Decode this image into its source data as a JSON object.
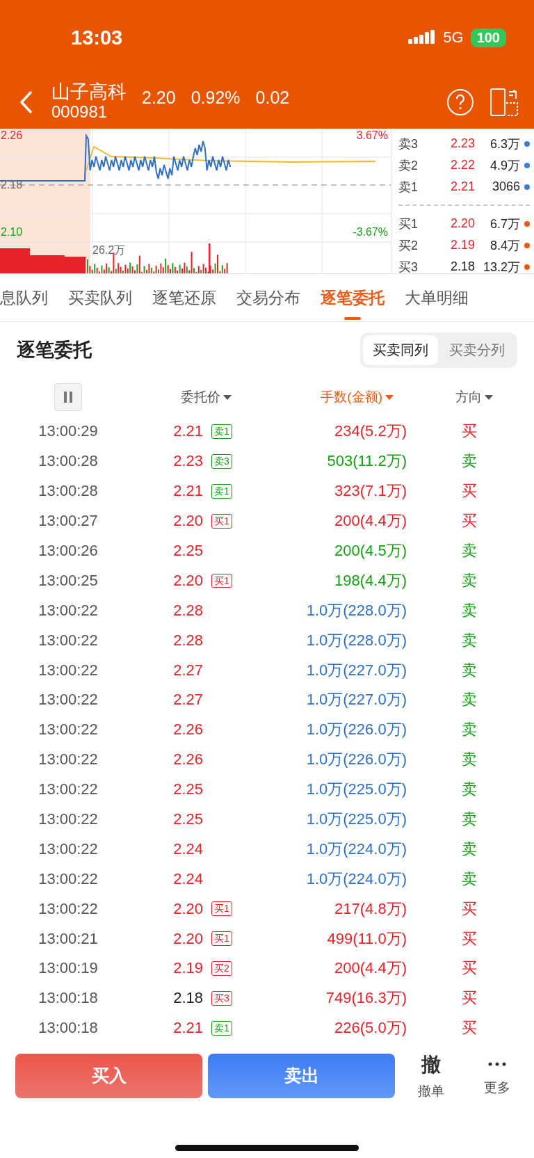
{
  "status_bar": {
    "time": "13:03",
    "network": "5G",
    "battery": "100"
  },
  "header": {
    "name": "山子高科",
    "code": "000981",
    "price": "2.20",
    "change_pct": "0.92%",
    "change": "0.02"
  },
  "chart": {
    "price_high": "2.26",
    "prev_close": "2.18",
    "price_low": "2.10",
    "pct_high": "3.67%",
    "pct_low": "-3.67%",
    "volume_label": "26.2万"
  },
  "order_book": {
    "asks": [
      {
        "label": "卖3",
        "price": "2.23",
        "rising": true,
        "volume": "6.3万",
        "color": "#3b7dd8"
      },
      {
        "label": "卖2",
        "price": "2.22",
        "rising": true,
        "volume": "4.9万",
        "color": "#3b7dd8"
      },
      {
        "label": "卖1",
        "price": "2.21",
        "rising": true,
        "volume": "3066",
        "color": "#3b7dd8"
      }
    ],
    "bids": [
      {
        "label": "买1",
        "price": "2.20",
        "rising": true,
        "volume": "6.7万",
        "color": "#ea5a0c"
      },
      {
        "label": "买2",
        "price": "2.19",
        "rising": true,
        "volume": "8.4万",
        "color": "#ea5a0c"
      },
      {
        "label": "买3",
        "price": "2.18",
        "rising": false,
        "volume": "13.2万",
        "color": "#ea5a0c"
      }
    ]
  },
  "tabs": [
    {
      "label": "息队列",
      "selected": false
    },
    {
      "label": "买卖队列",
      "selected": false
    },
    {
      "label": "逐笔还原",
      "selected": false
    },
    {
      "label": "交易分布",
      "selected": false
    },
    {
      "label": "逐笔委托",
      "selected": true
    },
    {
      "label": "大单明细",
      "selected": false
    }
  ],
  "section": {
    "title": "逐笔委托",
    "modes": [
      {
        "label": "买卖同列",
        "selected": true
      },
      {
        "label": "买卖分列",
        "selected": false
      }
    ]
  },
  "table": {
    "columns": [
      {
        "label": "委托价",
        "selected": false
      },
      {
        "label": "手数(金额)",
        "selected": true
      },
      {
        "label": "方向",
        "selected": false
      }
    ],
    "rows": [
      {
        "time": "13:00:29",
        "price": "2.21",
        "rising": true,
        "tag": {
          "text": "卖1",
          "kind": "sell"
        },
        "amount": "234(5.2万)",
        "kind": "buy",
        "direction": "买",
        "is_buy": true
      },
      {
        "time": "13:00:28",
        "price": "2.23",
        "rising": true,
        "tag": {
          "text": "卖3",
          "kind": "sell"
        },
        "amount": "503(11.2万)",
        "kind": "sell",
        "direction": "卖",
        "is_buy": false
      },
      {
        "time": "13:00:28",
        "price": "2.21",
        "rising": true,
        "tag": {
          "text": "卖1",
          "kind": "sell"
        },
        "amount": "323(7.1万)",
        "kind": "buy",
        "direction": "买",
        "is_buy": true
      },
      {
        "time": "13:00:27",
        "price": "2.20",
        "rising": true,
        "tag": {
          "text": "买1",
          "kind": "buy"
        },
        "amount": "200(4.4万)",
        "kind": "buy",
        "direction": "买",
        "is_buy": true
      },
      {
        "time": "13:00:26",
        "price": "2.25",
        "rising": true,
        "amount": "200(4.5万)",
        "kind": "sell",
        "direction": "卖",
        "is_buy": false
      },
      {
        "time": "13:00:25",
        "price": "2.20",
        "rising": true,
        "tag": {
          "text": "买1",
          "kind": "buy"
        },
        "amount": "198(4.4万)",
        "kind": "sell",
        "direction": "卖",
        "is_buy": false
      },
      {
        "time": "13:00:22",
        "price": "2.28",
        "rising": true,
        "amount": "1.0万(228.0万)",
        "kind": "large",
        "direction": "卖",
        "is_buy": false
      },
      {
        "time": "13:00:22",
        "price": "2.28",
        "rising": true,
        "amount": "1.0万(228.0万)",
        "kind": "large",
        "direction": "卖",
        "is_buy": false
      },
      {
        "time": "13:00:22",
        "price": "2.27",
        "rising": true,
        "amount": "1.0万(227.0万)",
        "kind": "large",
        "direction": "卖",
        "is_buy": false
      },
      {
        "time": "13:00:22",
        "price": "2.27",
        "rising": true,
        "amount": "1.0万(227.0万)",
        "kind": "large",
        "direction": "卖",
        "is_buy": false
      },
      {
        "time": "13:00:22",
        "price": "2.26",
        "rising": true,
        "amount": "1.0万(226.0万)",
        "kind": "large",
        "direction": "卖",
        "is_buy": false
      },
      {
        "time": "13:00:22",
        "price": "2.26",
        "rising": true,
        "amount": "1.0万(226.0万)",
        "kind": "large",
        "direction": "卖",
        "is_buy": false
      },
      {
        "time": "13:00:22",
        "price": "2.25",
        "rising": true,
        "amount": "1.0万(225.0万)",
        "kind": "large",
        "direction": "卖",
        "is_buy": false
      },
      {
        "time": "13:00:22",
        "price": "2.25",
        "rising": true,
        "amount": "1.0万(225.0万)",
        "kind": "large",
        "direction": "卖",
        "is_buy": false
      },
      {
        "time": "13:00:22",
        "price": "2.24",
        "rising": true,
        "amount": "1.0万(224.0万)",
        "kind": "large",
        "direction": "卖",
        "is_buy": false
      },
      {
        "time": "13:00:22",
        "price": "2.24",
        "rising": true,
        "amount": "1.0万(224.0万)",
        "kind": "large",
        "direction": "卖",
        "is_buy": false
      },
      {
        "time": "13:00:22",
        "price": "2.20",
        "rising": true,
        "tag": {
          "text": "买1",
          "kind": "buy"
        },
        "amount": "217(4.8万)",
        "kind": "buy",
        "direction": "买",
        "is_buy": true
      },
      {
        "time": "13:00:21",
        "price": "2.20",
        "rising": true,
        "tag": {
          "text": "买1",
          "kind": "buy"
        },
        "amount": "499(11.0万)",
        "kind": "buy",
        "direction": "买",
        "is_buy": true
      },
      {
        "time": "13:00:19",
        "price": "2.19",
        "rising": true,
        "tag": {
          "text": "买2",
          "kind": "buy"
        },
        "amount": "200(4.4万)",
        "kind": "buy",
        "direction": "买",
        "is_buy": true
      },
      {
        "time": "13:00:18",
        "price": "2.18",
        "rising": false,
        "tag": {
          "text": "买3",
          "kind": "buy"
        },
        "amount": "749(16.3万)",
        "kind": "buy",
        "direction": "买",
        "is_buy": true
      },
      {
        "time": "13:00:18",
        "price": "2.21",
        "rising": true,
        "tag": {
          "text": "卖1",
          "kind": "sell"
        },
        "amount": "226(5.0万)",
        "kind": "buy",
        "direction": "买",
        "is_buy": true
      }
    ]
  },
  "bottom_bar": {
    "buy": "买入",
    "sell": "卖出",
    "cancel_glyph": "撤",
    "cancel": "撤单",
    "more": "更多"
  }
}
